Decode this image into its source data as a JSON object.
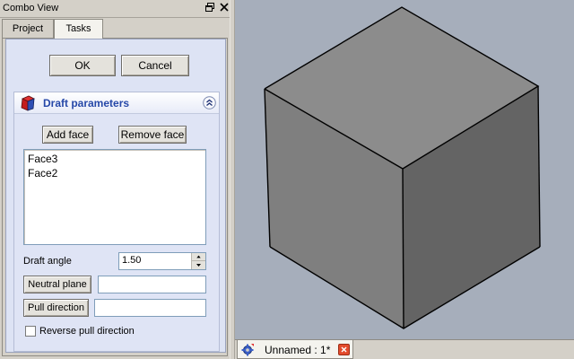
{
  "combo_view": {
    "title": "Combo View",
    "tabs": [
      {
        "label": "Project",
        "active": false
      },
      {
        "label": "Tasks",
        "active": true
      }
    ]
  },
  "dialog": {
    "ok_label": "OK",
    "cancel_label": "Cancel"
  },
  "draft_panel": {
    "title": "Draft parameters",
    "add_face_label": "Add face",
    "remove_face_label": "Remove face",
    "faces": [
      "Face3",
      "Face2"
    ],
    "draft_angle_label": "Draft angle",
    "draft_angle_value": "1.50",
    "neutral_plane_label": "Neutral plane",
    "neutral_plane_value": "",
    "pull_direction_label": "Pull direction",
    "pull_direction_value": "",
    "reverse_pull_label": "Reverse pull direction",
    "reverse_pull_checked": false
  },
  "viewport": {
    "background_color": "#a6aebb",
    "cube_colors": {
      "top": "#8c8c8c",
      "left": "#7f7f7f",
      "right": "#646464",
      "edge": "#000000"
    }
  },
  "document_tabs": [
    {
      "name": "Unnamed : 1*"
    }
  ],
  "icons": {
    "float": "float-window-icon",
    "close": "close-icon",
    "draft": "draft-feature-icon",
    "collapse": "collapse-chevrons-icon",
    "document": "document-gear-icon",
    "tab_close": "tab-close-icon"
  }
}
